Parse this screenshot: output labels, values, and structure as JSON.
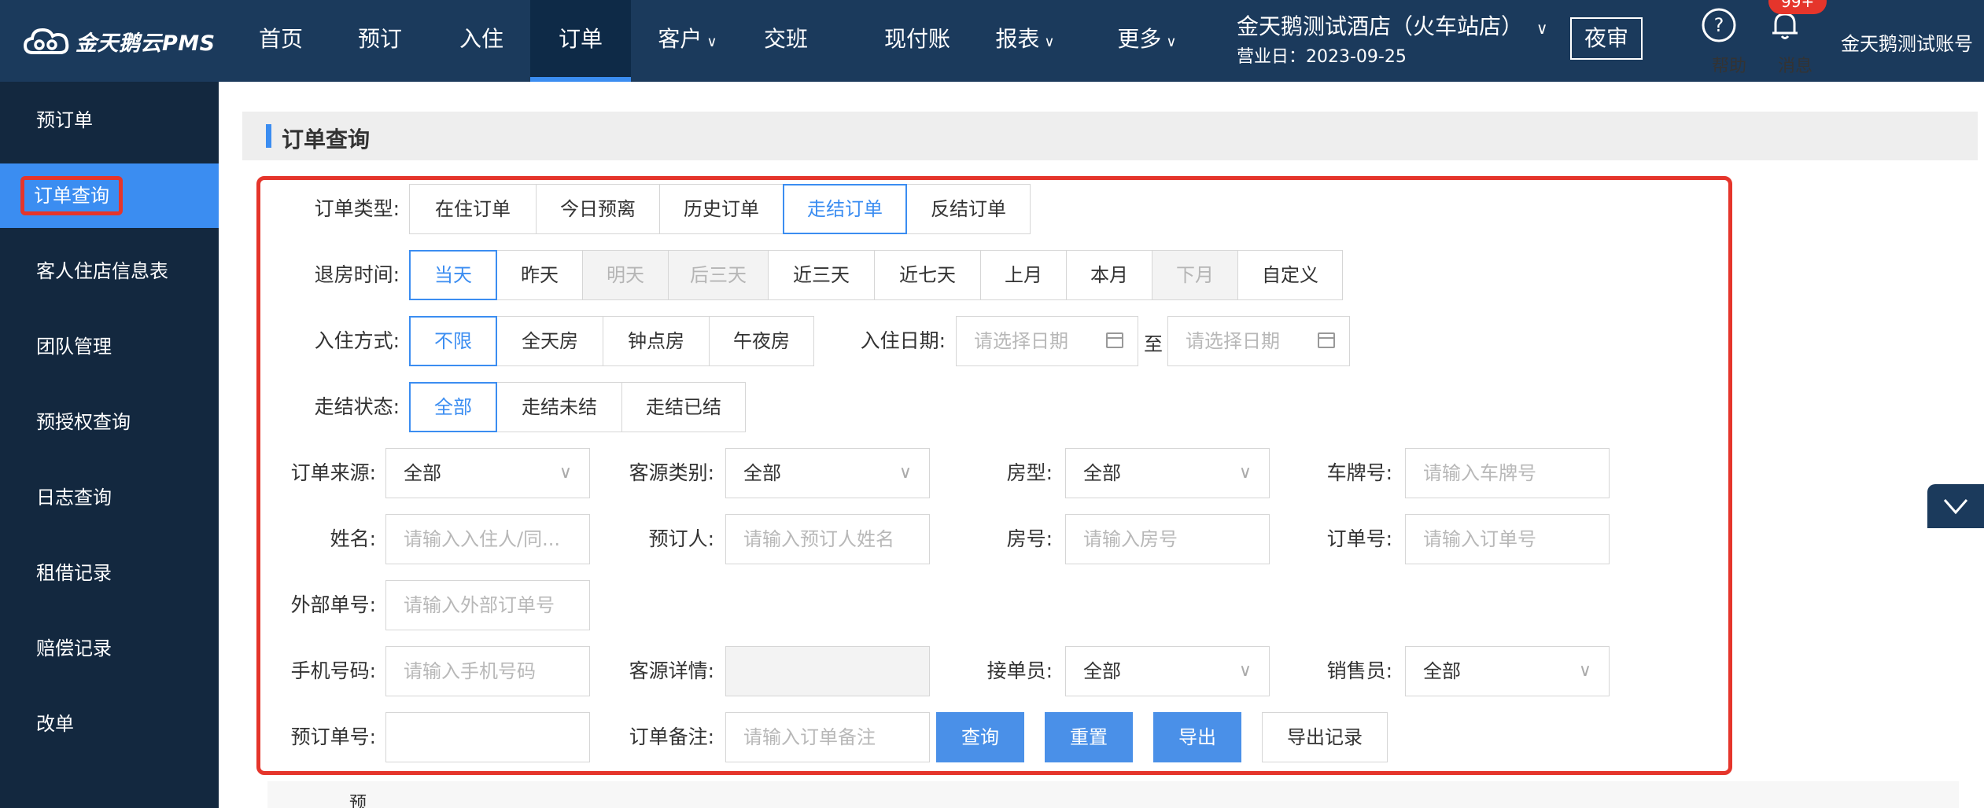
{
  "brand": {
    "name": "金天鹅云PMS"
  },
  "nav": [
    {
      "label": "首页",
      "dropdown": false,
      "active": false
    },
    {
      "label": "预订",
      "dropdown": false,
      "active": false
    },
    {
      "label": "入住",
      "dropdown": false,
      "active": false
    },
    {
      "label": "订单",
      "dropdown": false,
      "active": true
    },
    {
      "label": "客户",
      "dropdown": true,
      "active": false
    },
    {
      "label": "交班",
      "dropdown": false,
      "active": false
    },
    {
      "label": "现付账",
      "dropdown": false,
      "active": false
    },
    {
      "label": "报表",
      "dropdown": true,
      "active": false
    },
    {
      "label": "更多",
      "dropdown": true,
      "active": false
    }
  ],
  "hotel": {
    "name": "金天鹅测试酒店（火车站店）",
    "business_day": "营业日：2023-09-25"
  },
  "header_actions": {
    "night_audit": "夜审",
    "help": "帮助",
    "messages": "消息",
    "badge": "99+",
    "account": "金天鹅测试账号"
  },
  "sidebar": [
    {
      "label": "预订单",
      "active": false
    },
    {
      "label": "订单查询",
      "active": true
    },
    {
      "label": "客人住店信息表",
      "active": false
    },
    {
      "label": "团队管理",
      "active": false
    },
    {
      "label": "预授权查询",
      "active": false
    },
    {
      "label": "日志查询",
      "active": false
    },
    {
      "label": "租借记录",
      "active": false
    },
    {
      "label": "赔偿记录",
      "active": false
    },
    {
      "label": "改单",
      "active": false
    }
  ],
  "page": {
    "title": "订单查询"
  },
  "filters": {
    "order_type": {
      "label": "订单类型:",
      "options": [
        "在住订单",
        "今日预离",
        "历史订单",
        "走结订单",
        "反结订单"
      ],
      "selected": "走结订单"
    },
    "checkout_time": {
      "label": "退房时间:",
      "options": [
        "当天",
        "昨天",
        "明天",
        "后三天",
        "近三天",
        "近七天",
        "上月",
        "本月",
        "下月",
        "自定义"
      ],
      "selected": "当天",
      "disabled": [
        "明天",
        "后三天",
        "下月"
      ]
    },
    "checkin_mode": {
      "label": "入住方式:",
      "options": [
        "不限",
        "全天房",
        "钟点房",
        "午夜房"
      ],
      "selected": "不限"
    },
    "checkin_date": {
      "label": "入住日期:",
      "start_placeholder": "请选择日期",
      "end_placeholder": "请选择日期",
      "to": "至"
    },
    "settle_status": {
      "label": "走结状态:",
      "options": [
        "全部",
        "走结未结",
        "走结已结"
      ],
      "selected": "全部"
    },
    "order_source": {
      "label": "订单来源:",
      "value": "全部"
    },
    "guest_type": {
      "label": "客源类别:",
      "value": "全部"
    },
    "room_type": {
      "label": "房型:",
      "value": "全部"
    },
    "plate": {
      "label": "车牌号:",
      "placeholder": "请输入车牌号"
    },
    "name": {
      "label": "姓名:",
      "placeholder": "请输入入住人/同..."
    },
    "booker": {
      "label": "预订人:",
      "placeholder": "请输入预订人姓名"
    },
    "room_no": {
      "label": "房号:",
      "placeholder": "请输入房号"
    },
    "order_no": {
      "label": "订单号:",
      "placeholder": "请输入订单号"
    },
    "external_no": {
      "label": "外部单号:",
      "placeholder": "请输入外部订单号"
    },
    "phone": {
      "label": "手机号码:",
      "placeholder": "请输入手机号码"
    },
    "guest_detail": {
      "label": "客源详情:",
      "value": ""
    },
    "receiver": {
      "label": "接单员:",
      "value": "全部"
    },
    "salesperson": {
      "label": "销售员:",
      "value": "全部"
    },
    "booking_no": {
      "label": "预订单号:",
      "value": ""
    },
    "remark": {
      "label": "订单备注:",
      "placeholder": "请输入订单备注"
    }
  },
  "actions": {
    "query": "查询",
    "reset": "重置",
    "export": "导出",
    "export_log": "导出记录"
  },
  "table_peek": {
    "first_header": "预"
  },
  "colors": {
    "topbar": "#1b3a5c",
    "sidebar": "#13283f",
    "accent": "#3b8df1",
    "highlight": "#e5352b"
  },
  "icons": {
    "logo": "cloud-logo-icon",
    "help": "help-circle-icon",
    "messages": "bell-icon",
    "dropdown": "chevron-down-icon",
    "calendar": "calendar-icon",
    "collapse": "chevron-down-icon"
  }
}
